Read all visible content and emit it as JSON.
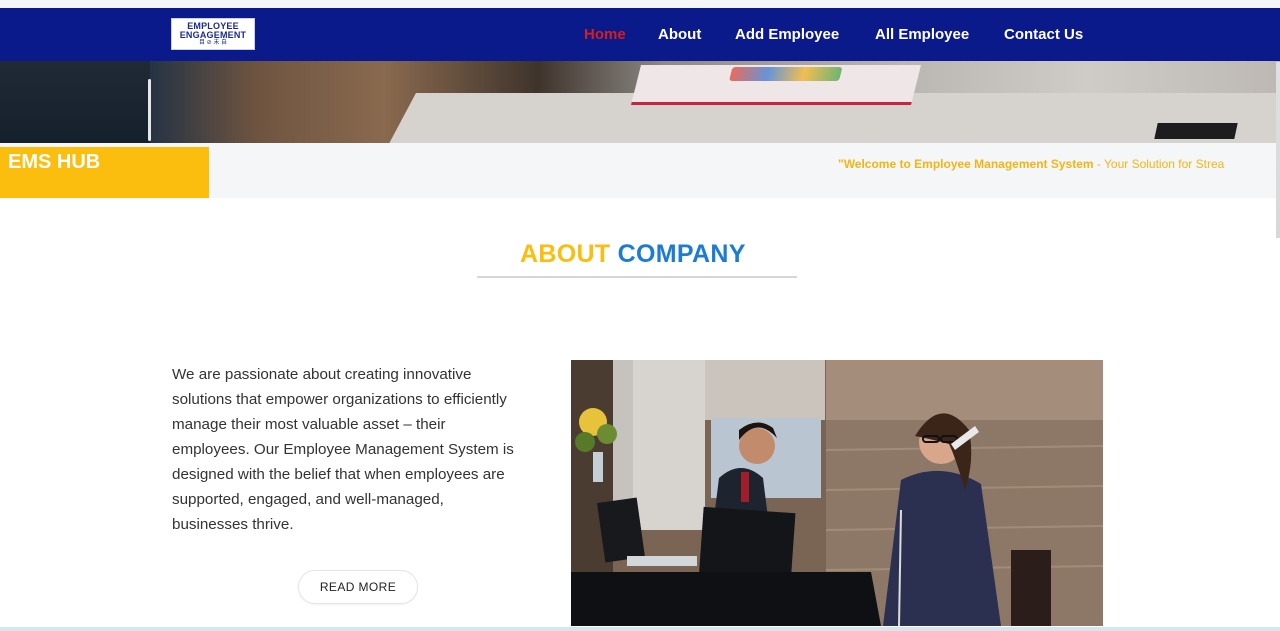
{
  "nav": {
    "logo_line1": "EMPLOYEE",
    "logo_line2": "ENGAGEMENT",
    "logo_line3": "目 ⊘ 未 自",
    "items": [
      {
        "label": "Home",
        "active": true
      },
      {
        "label": "About"
      },
      {
        "label": "Add Employee"
      },
      {
        "label": "All Employee"
      },
      {
        "label": "Contact Us"
      }
    ]
  },
  "banner": {
    "brand": "EMS HUB",
    "marquee_bold": "\"Welcome to Employee Management System",
    "marquee_rest": " - Your Solution for Strea"
  },
  "about": {
    "heading_part1": "ABOUT",
    "heading_part2": "COMPANY",
    "paragraph": "We are passionate about creating innovative solutions that empower organizations to efficiently manage their most valuable asset – their employees. Our Employee Management System is designed with the belief that when employees are supported, engaged, and well-managed, businesses thrive.",
    "read_more": "READ MORE"
  },
  "colors": {
    "navbar": "#0b1a8a",
    "accent_yellow": "#fbbd0e",
    "accent_blue": "#1b7cd6",
    "active_nav": "#d71d1d"
  }
}
